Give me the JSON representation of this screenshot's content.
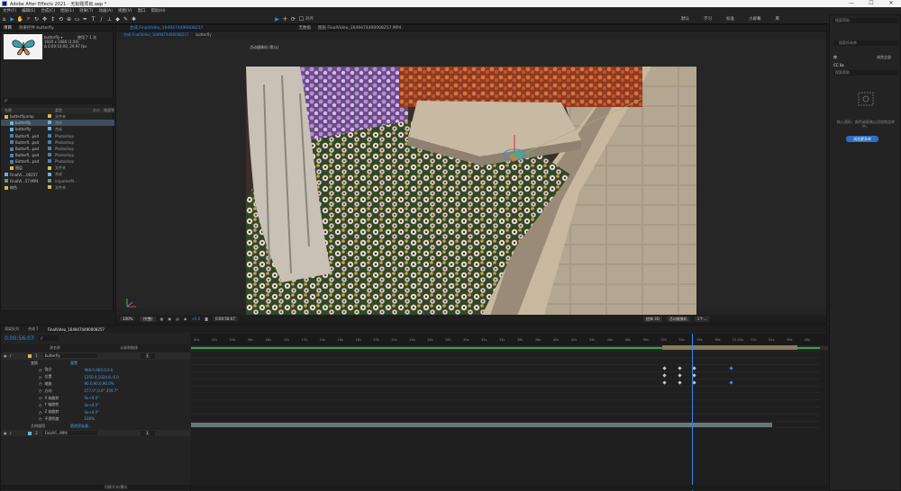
{
  "window": {
    "title": "Adobe After Effects 2021 - 无标题项目.aep *",
    "controls": [
      "—",
      "☐",
      "✕"
    ]
  },
  "menu": [
    "文件(F)",
    "编辑(E)",
    "合成(C)",
    "图层(L)",
    "效果(T)",
    "动画(A)",
    "视图(V)",
    "窗口",
    "帮助(H)"
  ],
  "workspaces": [
    "默认",
    "学习",
    "标准",
    "小屏幕",
    "库"
  ],
  "toolbar": {
    "snap_label": "对齐"
  },
  "project": {
    "tabs": [
      "项目",
      "效果控件 butterfly"
    ],
    "thumb_name": "butterfly",
    "info_lines": [
      "butterfly ▾",
      "1920 x 1080 (1.00)",
      "Δ 0;00;10;00, 29.97 fps"
    ],
    "used_label": "使用了 1 次",
    "search_placeholder": "ρ",
    "columns": [
      "名称",
      "类型",
      "大小",
      "帧速率"
    ],
    "rows": [
      {
        "name": "butterfly.xmp",
        "type": "文件夹",
        "size": "",
        "color": "#d9b94b",
        "indent": 0,
        "selected": false
      },
      {
        "name": "butterfly",
        "type": "合成",
        "size": "",
        "color": "#6fb0d8",
        "indent": 1,
        "selected": true
      },
      {
        "name": "butterfly",
        "type": "合成",
        "size": "",
        "color": "#6fb0d8",
        "indent": 1,
        "selected": false
      },
      {
        "name": "Butterfl...psd",
        "type": "Photoshop",
        "size": "",
        "color": "#4f7fa8",
        "indent": 1,
        "selected": false
      },
      {
        "name": "Butterfl...psd",
        "type": "Photoshop",
        "size": "",
        "color": "#4f7fa8",
        "indent": 1,
        "selected": false
      },
      {
        "name": "Butterfl...psd",
        "type": "Photoshop",
        "size": "",
        "color": "#4f7fa8",
        "indent": 1,
        "selected": false
      },
      {
        "name": "Butterfl...psd",
        "type": "Photoshop",
        "size": "",
        "color": "#4f7fa8",
        "indent": 1,
        "selected": false
      },
      {
        "name": "Butterfl...psd",
        "type": "Photoshop",
        "size": "",
        "color": "#4f7fa8",
        "indent": 1,
        "selected": false
      },
      {
        "name": "图层",
        "type": "文件夹",
        "size": "",
        "color": "#d9b94b",
        "indent": 1,
        "selected": false
      },
      {
        "name": "FinalVi....00257",
        "type": "合成",
        "size": "",
        "color": "#6fb0d8",
        "indent": 0,
        "selected": false
      },
      {
        "name": "FinalVi...57.MP4",
        "type": "ImporterM...",
        "size": "",
        "color": "#5a9a7a",
        "indent": 0,
        "selected": false
      },
      {
        "name": "纯色",
        "type": "文件夹",
        "size": "",
        "color": "#d9b94b",
        "indent": 0,
        "selected": false
      }
    ]
  },
  "viewer": {
    "tabs": [
      "合成 FinalVideo_1649474490008257",
      "butterfly"
    ],
    "side_tabs": [
      "无数据",
      "图层 FinalVideo_1649474490008257.MP4"
    ],
    "render_note": "活动摄像机 (默认)",
    "zoom": "100%",
    "quality": "(完整)",
    "timecode": "0:00:56:07",
    "exposure": "+0.0",
    "renderer": "经典 3D",
    "camera": "活动摄像机",
    "views": "1个..."
  },
  "right_panel": {
    "search_placeholder": "搜索帮助",
    "lib_search_placeholder": "搜索所有库",
    "lib_label": "库",
    "lib_name": "CC lia",
    "lib_browse": "浏览全部",
    "empty_text": "拖入图形、颜色或画笔以添加到此库中。",
    "button_label": "浏览更多库"
  },
  "timeline": {
    "tabs": [
      "渲染队列",
      "合成 1",
      "FinalVideo_1649474490008257"
    ],
    "timecode": "0:00:56:07",
    "search_placeholder": "ρ",
    "columns": [
      "源名称",
      "父级和链接"
    ],
    "rows": [
      {
        "kind": "layer",
        "num": "1",
        "name": "butterfly",
        "parent": "无",
        "color": "#d9b94b"
      },
      {
        "kind": "group",
        "name": "变换",
        "value": "重置"
      },
      {
        "kind": "prop",
        "name": "锚点",
        "value": "960.0,960.0,0.0"
      },
      {
        "kind": "prop",
        "name": "位置",
        "value": "1250.4,1024.8,-6.0"
      },
      {
        "kind": "prop",
        "name": "缩放",
        "value": "90.0,90.0,90.0%"
      },
      {
        "kind": "prop",
        "name": "方向",
        "value": "277.0°,0.0°,359.7°"
      },
      {
        "kind": "prop",
        "name": "X 轴旋转",
        "value": "0x+0.0°"
      },
      {
        "kind": "prop",
        "name": "Y 轴旋转",
        "value": "0x+0.0°"
      },
      {
        "kind": "prop",
        "name": "Z 轴旋转",
        "value": "0x+0.0°"
      },
      {
        "kind": "prop",
        "name": "不透明度",
        "value": "100%"
      },
      {
        "kind": "group",
        "name": "几何选项",
        "value": "更改渲染器..."
      },
      {
        "kind": "layer",
        "num": "2",
        "name": "FinalVi...MP4",
        "parent": "无",
        "color": "#6fb0d8"
      }
    ],
    "ruler_labels": [
      "00s",
      "02s",
      "04s",
      "06s",
      "08s",
      "10s",
      "12s",
      "14s",
      "16s",
      "18s",
      "20s",
      "22s",
      "24s",
      "26s",
      "28s",
      "30s",
      "32s",
      "34s",
      "36s",
      "38s",
      "40s",
      "42s",
      "44s",
      "46s",
      "48s",
      "50s",
      "52s",
      "54s",
      "56s",
      "58s",
      "01:00s",
      "02s",
      "04s",
      "06s",
      "08s"
    ],
    "status": "切换开关/模式"
  }
}
